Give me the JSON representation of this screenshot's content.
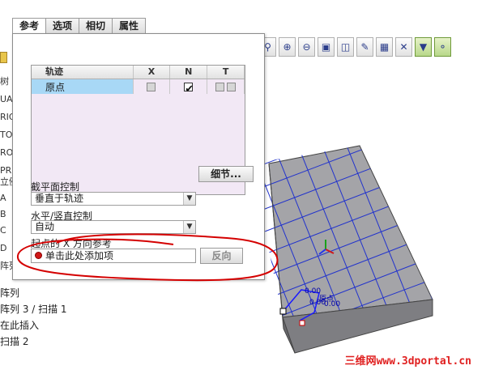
{
  "tabs": [
    "参考",
    "选项",
    "相切",
    "属性"
  ],
  "toolbar": {
    "icons": [
      "zoom-window-icon",
      "zoom-in-icon",
      "zoom-out-icon",
      "refit-icon",
      "shade-icon",
      "saved-views-icon",
      "layers-icon",
      "spin-center-icon",
      "datum-display-icon",
      "datum-planes-icon"
    ]
  },
  "tree_partial": [
    "树",
    "UA",
    "RIG",
    "TO",
    "RO",
    "PR",
    "立例",
    "A",
    "B",
    "C",
    "D",
    "阵列"
  ],
  "lower_tree": [
    "阵列 3 / 扫描 1",
    "在此插入",
    "扫描 2"
  ],
  "lower_tree_partial": [
    "阵列"
  ],
  "trajectory_table": {
    "headers": [
      "轨迹",
      "X",
      "N",
      "T"
    ],
    "rows": [
      {
        "name": "原点",
        "x": false,
        "n": true,
        "t": false
      }
    ]
  },
  "details_button": "细节...",
  "section_control": {
    "label": "截平面控制",
    "value": "垂直于轨迹"
  },
  "hv_control": {
    "label": "水平/竖直控制",
    "value": "自动"
  },
  "x_ref": {
    "label": "起点的 X 方向参考",
    "placeholder": "单击此处添加项",
    "flip_button": "反向"
  },
  "model_labels": [
    "0.00",
    "原点",
    "0.00",
    "0.00"
  ],
  "watermark": "三维网www.3dportal.cn"
}
